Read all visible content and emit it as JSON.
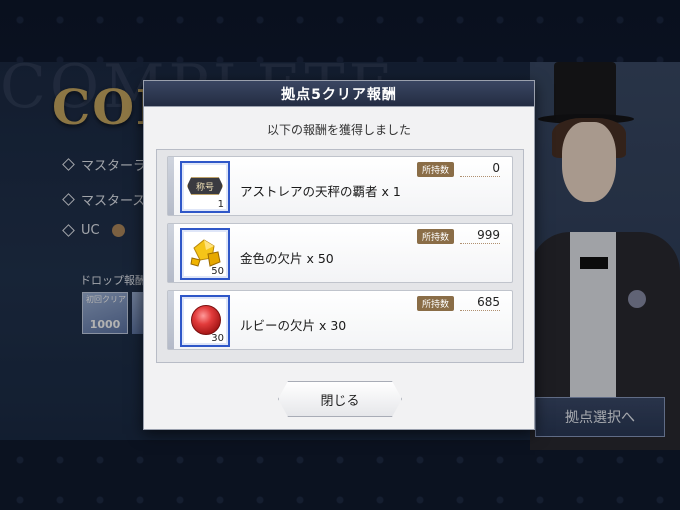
{
  "background": {
    "title": "COMPLETE",
    "ghost_title": "COMPLETE",
    "rows": [
      "マスターラ",
      "マスタース",
      "UC"
    ],
    "drop_label": "ドロップ報酬",
    "drop_box_tag": "初回クリア",
    "drop_box_value": "1000",
    "choose_button": "拠点選択へ"
  },
  "dialog": {
    "title": "拠点5クリア報酬",
    "subtitle": "以下の報酬を獲得しました",
    "own_label": "所持数",
    "rewards": [
      {
        "name": "アストレアの天秤の覇者 x 1",
        "thumb_count": "1",
        "own": "0",
        "icon": "title-plate-icon",
        "icon_text": "称号"
      },
      {
        "name": "金色の欠片 x 50",
        "thumb_count": "50",
        "own": "999",
        "icon": "gold-fragment-icon"
      },
      {
        "name": "ルビーの欠片 x 30",
        "thumb_count": "30",
        "own": "685",
        "icon": "ruby-fragment-icon"
      }
    ],
    "close_button": "閉じる"
  },
  "colors": {
    "header_bg": "#2b3550",
    "thumb_border": "#2f57c8",
    "own_tag": "#8a6d47",
    "title_gold": "#c9a962"
  }
}
